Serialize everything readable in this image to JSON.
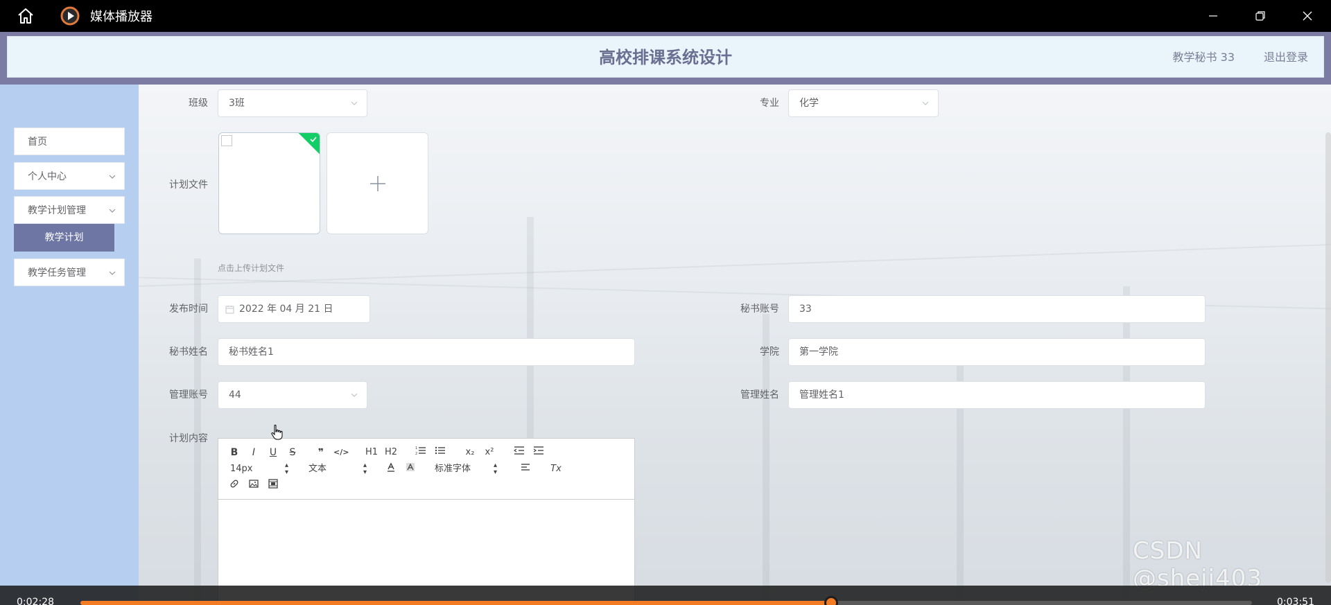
{
  "window": {
    "title": "媒体播放器",
    "controls": [
      "minimize",
      "restore",
      "close"
    ]
  },
  "header": {
    "title": "高校排课系统设计",
    "user": "教学秘书 33",
    "logout": "退出登录",
    "accent": "#7b7ba3"
  },
  "sidebar": {
    "items": [
      {
        "label": "首页"
      },
      {
        "label": "个人中心"
      },
      {
        "label": "教学计划管理"
      },
      {
        "label": "教学任务管理"
      }
    ],
    "active_sub": "教学计划"
  },
  "form": {
    "class_label": "班级",
    "class_value": "3班",
    "major_label": "专业",
    "major_value": "化学",
    "file_label": "计划文件",
    "file_tip": "点击上传计划文件",
    "publish_label": "发布时间",
    "publish_value": "2022 年 04 月 21 日",
    "secretary_account_label": "秘书账号",
    "secretary_account_value": "33",
    "secretary_name_label": "秘书姓名",
    "secretary_name_value": "秘书姓名1",
    "college_label": "学院",
    "college_value": "第一学院",
    "admin_account_label": "管理账号",
    "admin_account_value": "44",
    "admin_name_label": "管理姓名",
    "admin_name_value": "管理姓名1",
    "content_label": "计划内容"
  },
  "editor": {
    "font_size": "14px",
    "header_type": "文本",
    "font_family": "标准字体",
    "tools": {
      "bold": "B",
      "italic": "I",
      "underline": "U",
      "strike": "S",
      "quote": "❞",
      "code": "</>",
      "h1": "H1",
      "h2": "H2",
      "sub": "x₂",
      "sup": "x²",
      "clear": "Tx"
    }
  },
  "player": {
    "elapsed": "0:02:28",
    "total": "0:03:51",
    "progress": 0.641,
    "accent": "#f37b24"
  },
  "watermark": "CSDN @sheji403"
}
